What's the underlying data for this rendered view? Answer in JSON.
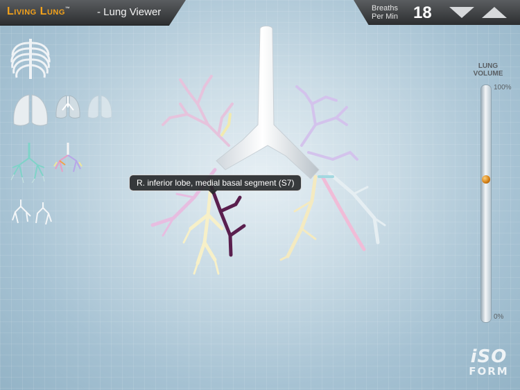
{
  "header": {
    "brand": "Living Lung",
    "trademark": "™",
    "subtitle": "- Lung Viewer",
    "bpm_label_line1": "Breaths",
    "bpm_label_line2": "Per Min",
    "bpm_value": "18"
  },
  "sidebar": {
    "items": [
      {
        "name": "rib-cage-thumbnail"
      },
      {
        "name": "lungs-solid-thumbnail"
      },
      {
        "name": "lungs-translucent-thumbnail"
      },
      {
        "name": "lungs-ghost-thumbnail"
      },
      {
        "name": "bronchial-tree-teal-thumbnail"
      },
      {
        "name": "bronchial-tree-color-thumbnail"
      },
      {
        "name": "bronchial-tree-white-thumbnail"
      },
      {
        "name": "bronchial-tree-white-small-thumbnail"
      }
    ]
  },
  "lung_volume": {
    "title_line1": "LUNG",
    "title_line2": "VOLUME",
    "max_label": "100%",
    "min_label": "0%",
    "value_fraction": 0.6
  },
  "tooltip": {
    "text": "R. inferior lobe, medial basal segment (S7)"
  },
  "logo": {
    "line1": "iSO",
    "line2": "FORM"
  },
  "colors": {
    "brand": "#f4a21b",
    "highlight_segment": "#5a1f4e",
    "knob": "#d07a10"
  }
}
